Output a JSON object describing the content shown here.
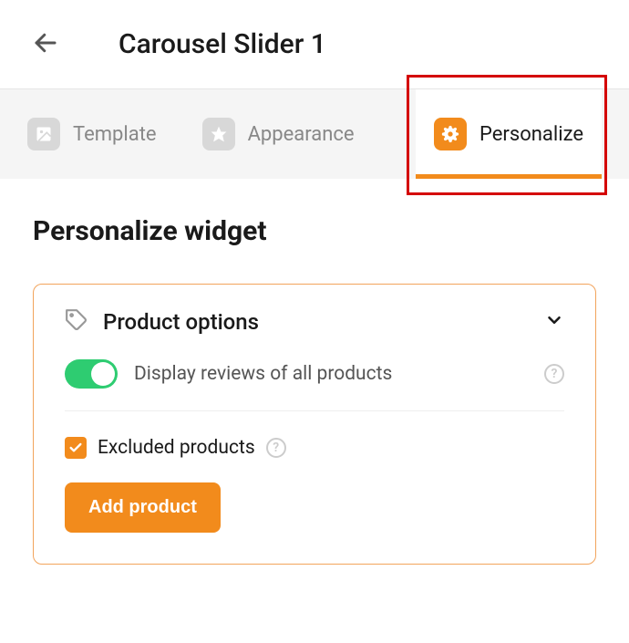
{
  "header": {
    "title": "Carousel Slider 1"
  },
  "tabs": {
    "template": {
      "label": "Template"
    },
    "appearance": {
      "label": "Appearance"
    },
    "personalize": {
      "label": "Personalize"
    }
  },
  "section": {
    "title": "Personalize widget"
  },
  "panel": {
    "title": "Product options",
    "display_reviews_label": "Display reviews of all products",
    "excluded_label": "Excluded products",
    "add_button_label": "Add product"
  }
}
